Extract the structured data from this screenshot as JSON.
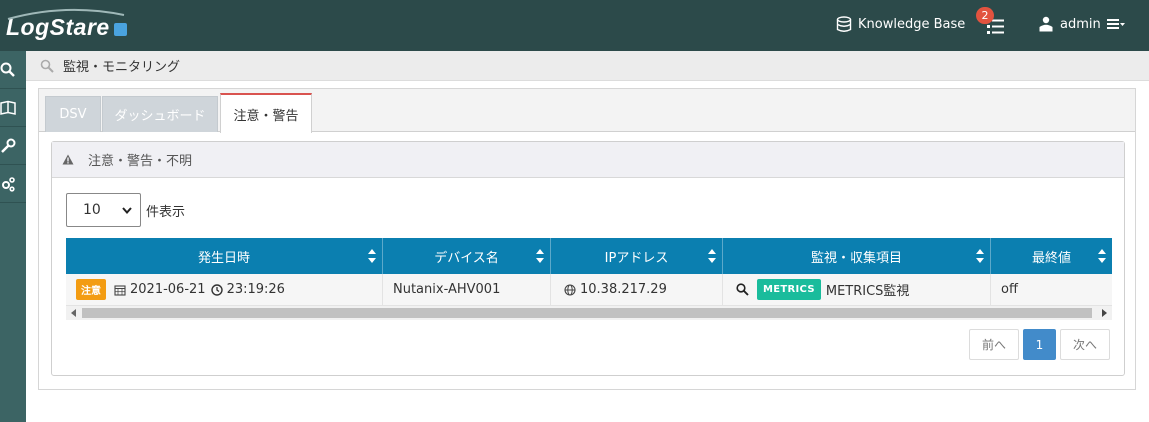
{
  "app": {
    "logo_text": "LogStare",
    "knowledge_base_label": "Knowledge Base",
    "notification_count": "2",
    "user_name": "admin"
  },
  "sidebar": {
    "items": [
      {
        "icon": "search-icon"
      },
      {
        "icon": "book-icon"
      },
      {
        "icon": "wrench-icon"
      },
      {
        "icon": "gears-icon"
      }
    ]
  },
  "breadcrumb": {
    "label": "監視・モニタリング"
  },
  "tabs": [
    {
      "label": "DSV",
      "active": false
    },
    {
      "label": "ダッシュボード",
      "active": false
    },
    {
      "label": "注意・警告",
      "active": true
    }
  ],
  "panel": {
    "title": "注意・警告・不明",
    "page_length": "10",
    "page_length_suffix": "件表示"
  },
  "table": {
    "headers": [
      "発生日時",
      "デバイス名",
      "IPアドレス",
      "監視・収集項目",
      "最終値"
    ],
    "rows": [
      {
        "status_badge": "注意",
        "date": "2021-06-21",
        "time": "23:19:26",
        "device": "Nutanix-AHV001",
        "ip": "10.38.217.29",
        "item_badge": "METRICS",
        "item_name": "METRICS監視",
        "last_value": "off"
      }
    ]
  },
  "pagination": {
    "prev_label": "前へ",
    "current_page": "1",
    "next_label": "次へ"
  },
  "colors": {
    "topbar": "#2c4a4a",
    "sidebar": "#3c6464",
    "table_header": "#0b7fb0",
    "warn_badge": "#f39c12",
    "metrics_badge": "#1abc9c",
    "notification": "#e2533f",
    "active_page": "#428bca"
  }
}
